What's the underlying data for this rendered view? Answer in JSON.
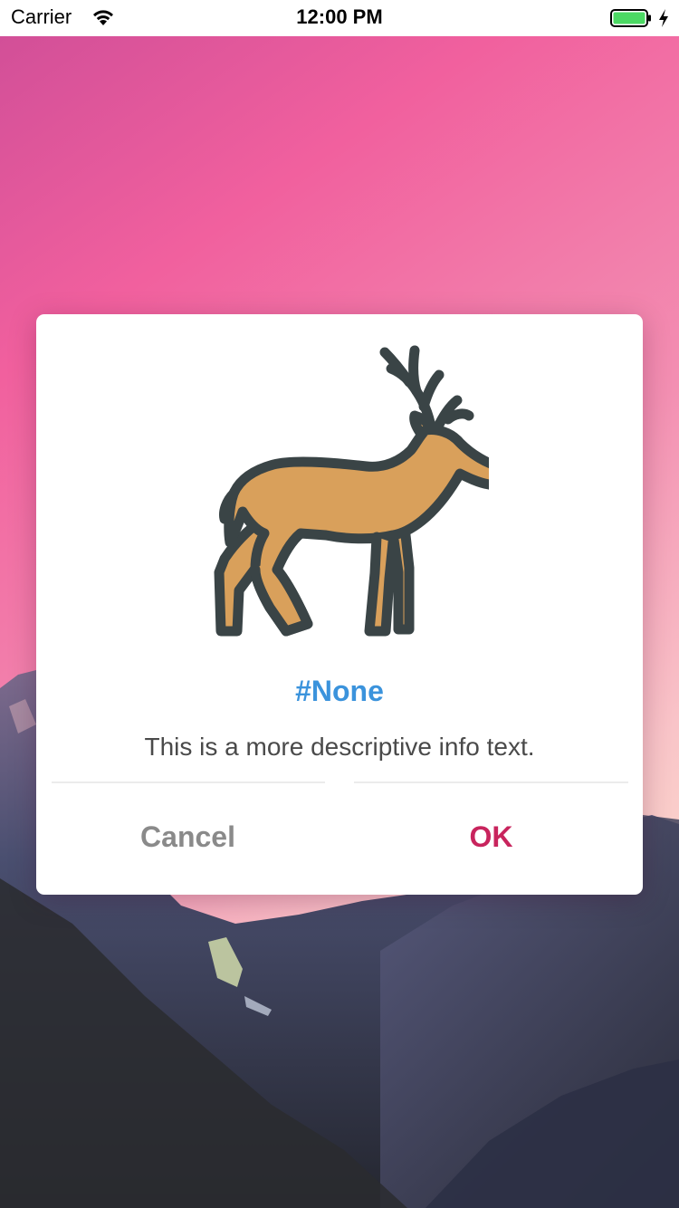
{
  "status_bar": {
    "carrier": "Carrier",
    "time": "12:00 PM",
    "wifi_icon": "wifi-icon",
    "battery_icon": "battery-icon",
    "charging_icon": "charging-bolt-icon",
    "battery_color": "#4cd964"
  },
  "dialog": {
    "icon": "deer-icon",
    "title": "#None",
    "message": "This is a more descriptive info text.",
    "cancel_label": "Cancel",
    "ok_label": "OK",
    "colors": {
      "title": "#3b93dc",
      "message": "#4a4a4a",
      "cancel": "#8a8a8a",
      "ok": "#c8245d",
      "deer_fill": "#d9a05b",
      "deer_outline": "#3a4446"
    }
  },
  "background": {
    "gradient_top": "#e04f9a",
    "gradient_bottom": "#f7a3b5",
    "mountain_color": "#3b3f5a"
  }
}
